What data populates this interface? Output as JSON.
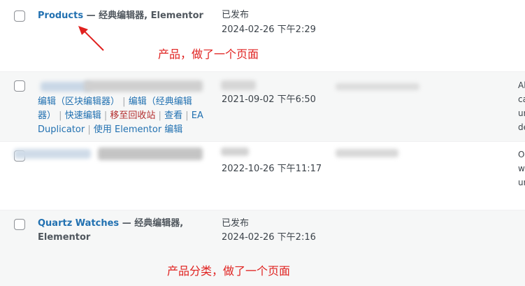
{
  "rows": [
    {
      "title": "Products",
      "dash": " — ",
      "state": "经典编辑器, Elementor",
      "status": "已发布",
      "datetime": "2024-02-26 下午2:29"
    },
    {
      "datetime": "2021-09-02 下午6:50",
      "actions": {
        "edit_block": "编辑（区块编辑器）",
        "edit_classic": "编辑（经典编辑器）",
        "quick_edit": "快速编辑",
        "trash": "移至回收站",
        "view": "查看",
        "duplicate": "EA Duplicator",
        "elementor": "使用 Elementor 编辑",
        "separator": "|"
      },
      "excerpt_cut": [
        "Al",
        "ca",
        "ur",
        "de"
      ]
    },
    {
      "datetime": "2022-10-26 下午11:17",
      "excerpt_cut": [
        "O",
        "w",
        "ur"
      ]
    },
    {
      "title": "Quartz Watches",
      "dash": " — ",
      "state_line1": "经典编辑器,",
      "state_line2": "Elementor",
      "status": "已发布",
      "datetime": "2024-02-26 下午2:16"
    }
  ],
  "annotations": {
    "products_note": "产品，做了一个页面",
    "category_note": "产品分类，做了一个页面"
  },
  "colors": {
    "link": "#2271b1",
    "trash": "#b32d2e",
    "annotation": "#e0211f",
    "alt_row": "#f6f7f7"
  }
}
